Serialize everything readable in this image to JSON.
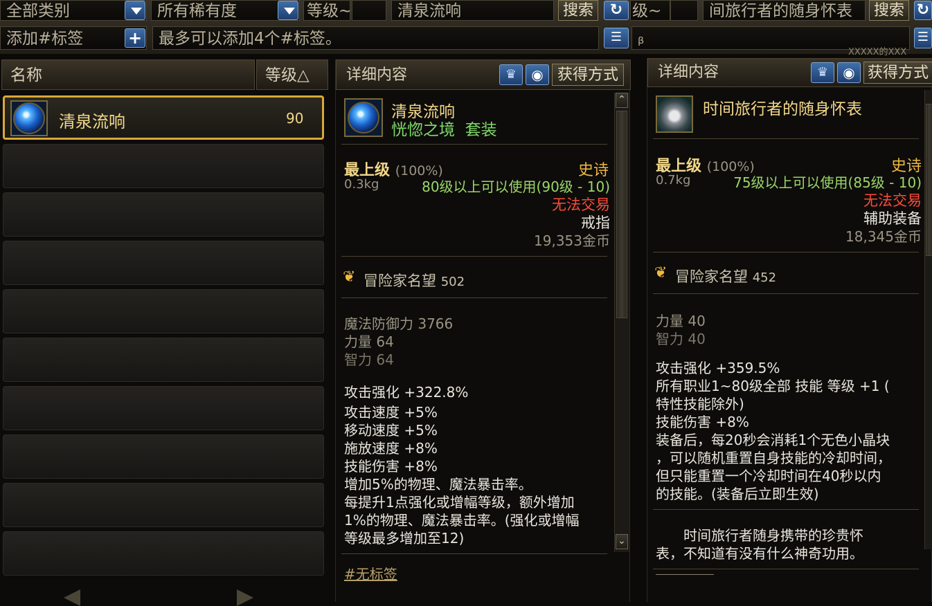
{
  "topbar": {
    "category": "全部类别",
    "rarity": "所有稀有度",
    "level_label": "等级",
    "level_tilde": "~",
    "search_value": "清泉流响",
    "search_button": "搜索",
    "right_level_label": "级",
    "right_level_tilde": "~",
    "right_search_value": "间旅行者的随身怀表",
    "right_search_button": "搜索",
    "tag_placeholder": "添加#标签",
    "tag_add": "+",
    "tag_hint": "最多可以添加4个#标签。",
    "watermark": "XXXXX的XXX"
  },
  "list": {
    "col_name": "名称",
    "col_level": "等级△",
    "items": [
      {
        "name": "清泉流响",
        "level": "90"
      }
    ]
  },
  "detail_left": {
    "header": "详细内容",
    "acquire": "获得方式",
    "item_name": "清泉流响",
    "set_name": "恍惚之境",
    "set_suffix": "套装",
    "grade": "最上级",
    "grade_pct": "(100%)",
    "rarity": "史诗",
    "weight": "0.3kg",
    "level_req": "80级以上可以使用(90级 - 10)",
    "trade": "无法交易",
    "slot": "戒指",
    "price": "19,353金币",
    "fame_label": "冒险家名望",
    "fame_value": "502",
    "stats": [
      "魔法防御力 3766",
      "力量 64",
      "智力 64"
    ],
    "effects": [
      "攻击强化 +322.8%",
      "攻击速度 +5%",
      "移动速度 +5%",
      "施放速度 +8%",
      "技能伤害 +8%",
      "增加5%的物理、魔法暴击率。",
      "每提升1点强化或增幅等级，额外增加",
      "1%的物理、魔法暴击率。(强化或增幅",
      "等级最多增加至12)"
    ],
    "tag": "#无标签"
  },
  "detail_right": {
    "header": "详细内容",
    "acquire": "获得方式",
    "item_name": "时间旅行者的随身怀表",
    "grade": "最上级",
    "grade_pct": "(100%)",
    "rarity": "史诗",
    "weight": "0.7kg",
    "level_req": "75级以上可以使用(85级 - 10)",
    "trade": "无法交易",
    "slot": "辅助装备",
    "price": "18,345金币",
    "fame_label": "冒险家名望",
    "fame_value": "452",
    "stats": [
      "力量 40",
      "智力 40"
    ],
    "effects": [
      "攻击强化 +359.5%",
      "所有职业1~80级全部 技能 等级 +1 (",
      "特性技能除外)",
      "技能伤害 +8%",
      "装备后，每20秒会消耗1个无色小晶块",
      "，可以随机重置自身技能的冷却时间，",
      "但只能重置一个冷却时间在40秒以内",
      "的技能。(装备后立即生效)"
    ],
    "flavor": [
      "时间旅行者随身携带的珍贵怀",
      "表，不知道有没有什么神奇功用。"
    ]
  },
  "icons": [
    "chevron-down-icon",
    "plus-icon",
    "refresh-icon",
    "list-icon",
    "compare-icon",
    "eye-icon",
    "scroll-up-icon",
    "scroll-down-icon",
    "page-left-icon",
    "page-right-icon",
    "fame-icon",
    "orb-icon",
    "pocket-watch-icon"
  ],
  "colors": {
    "rarity_epic": "#f0b840",
    "untradable": "#ff4a3a",
    "level_ok": "#7fd86a",
    "item_name": "#f3d88a",
    "selected_border": "#d8a83a"
  }
}
